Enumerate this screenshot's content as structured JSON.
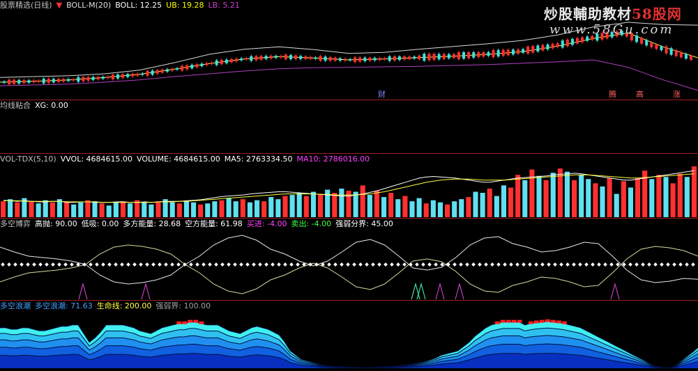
{
  "watermark": {
    "main": "炒股輔助教材",
    "brand": "58股网",
    "url": "www.58Gu.com"
  },
  "panels": {
    "boll": {
      "title": "股票精选(日线)",
      "indicator": "BOLL-M(20)",
      "items": [
        {
          "name": "BOLL",
          "value": "12.25",
          "color": "#ffffff"
        },
        {
          "name": "UB",
          "value": "19.28",
          "color": "#ffff00"
        },
        {
          "name": "LB",
          "value": "5.21",
          "color": "#d040d0"
        }
      ],
      "markers": [
        "财",
        "腾",
        "高",
        "涨"
      ]
    },
    "xg": {
      "title": "均线粘合",
      "items": [
        {
          "name": "XG",
          "value": "0.00",
          "color": "#ffffff"
        }
      ]
    },
    "vol": {
      "title": "VOL-TDX(5,10)",
      "items": [
        {
          "name": "VVOL",
          "value": "4684615.00",
          "color": "#ffffff"
        },
        {
          "name": "VOLUME",
          "value": "4684615.00",
          "color": "#ffffff"
        },
        {
          "name": "MA5",
          "value": "2763334.50",
          "color": "#ffffff"
        },
        {
          "name": "MA10",
          "value": "2786016.00",
          "color": "#ff40ff"
        }
      ]
    },
    "duokong": {
      "title": "多空博弈",
      "items": [
        {
          "name": "高抛",
          "value": "90.00",
          "color": "#ffffff"
        },
        {
          "name": "低吸",
          "value": "0.00",
          "color": "#ffffff"
        },
        {
          "name": "多方能量",
          "value": "28.68",
          "color": "#ffffff"
        },
        {
          "name": "空方能量",
          "value": "61.98",
          "color": "#ffffff"
        },
        {
          "name": "买进",
          "value": "-4.00",
          "color": "#ff40ff"
        },
        {
          "name": "卖出",
          "value": "-4.00",
          "color": "#40ff40"
        },
        {
          "name": "强弱分界",
          "value": "45.00",
          "color": "#ffffff"
        }
      ]
    },
    "wave": {
      "title": "多空浪潮",
      "items": [
        {
          "name": "多空浪潮",
          "value": "71.63",
          "color": "#40a0ff"
        },
        {
          "name": "生命线",
          "value": "200.00",
          "color": "#ffff40"
        },
        {
          "name": "强弱界",
          "value": "100.00",
          "color": "#a0a0a0"
        }
      ]
    }
  },
  "chart_data": [
    {
      "type": "line",
      "title": "BOLL-M(20)",
      "x": [
        0,
        10,
        20,
        30,
        40,
        50,
        60,
        70,
        80,
        90,
        100,
        110,
        120,
        130,
        140,
        150,
        160,
        170,
        180,
        190,
        200
      ],
      "series": [
        {
          "name": "UB",
          "values": [
            8.0,
            8.2,
            8.4,
            8.8,
            9.6,
            11.2,
            13.0,
            14.1,
            14.6,
            14.0,
            13.2,
            13.4,
            14.1,
            14.7,
            15.3,
            16.0,
            17.2,
            18.9,
            19.9,
            19.4,
            19.28
          ]
        },
        {
          "name": "BOLL",
          "values": [
            7.0,
            7.2,
            7.5,
            8.0,
            8.7,
            9.8,
            11.0,
            12.0,
            12.5,
            12.2,
            11.8,
            12.0,
            12.3,
            12.6,
            13.0,
            13.6,
            14.8,
            16.4,
            17.6,
            14.6,
            12.25
          ]
        },
        {
          "name": "LB",
          "values": [
            6.2,
            6.4,
            6.6,
            7.0,
            7.5,
            8.2,
            8.8,
            9.4,
            9.9,
            10.1,
            10.2,
            10.3,
            10.4,
            10.6,
            10.8,
            11.1,
            11.4,
            11.8,
            10.2,
            7.5,
            5.21
          ]
        }
      ]
    },
    {
      "type": "bar",
      "title": "VOL-TDX(5,10)",
      "values": [
        30,
        34,
        28,
        36,
        30,
        26,
        32,
        28,
        34,
        30,
        24,
        28,
        32,
        30,
        26,
        22,
        28,
        30,
        26,
        32,
        28,
        24,
        30,
        34,
        28,
        26,
        30,
        28,
        24,
        26,
        30,
        32,
        36,
        30,
        34,
        28,
        32,
        30,
        38,
        34,
        40,
        42,
        46,
        40,
        48,
        44,
        52,
        46,
        54,
        50,
        48,
        60,
        42,
        50,
        38,
        46,
        34,
        40,
        30,
        36,
        26,
        32,
        28,
        24,
        30,
        34,
        38,
        48,
        46,
        54,
        40,
        60,
        56,
        80,
        70,
        90,
        78,
        70,
        84,
        92,
        86,
        70,
        80,
        72,
        64,
        58,
        74,
        44,
        68,
        56,
        74,
        88,
        72,
        80,
        76,
        64,
        82,
        76,
        96
      ],
      "red_indices": [
        0,
        2,
        4,
        7,
        9,
        12,
        14,
        17,
        19,
        22,
        25,
        28,
        31,
        34,
        37,
        40,
        43,
        45,
        47,
        49,
        51,
        53,
        55,
        57,
        60,
        63,
        66,
        69,
        72,
        73,
        75,
        77,
        79,
        81,
        84,
        86,
        88,
        90,
        91,
        93,
        95,
        96,
        98
      ],
      "ma5": [
        32,
        31,
        30,
        31,
        30,
        29,
        29,
        30,
        30,
        28,
        28,
        29,
        29,
        28,
        28,
        28,
        29,
        29,
        28,
        28,
        29,
        28,
        29,
        30,
        30,
        30,
        31,
        32,
        33,
        35,
        37,
        39,
        40,
        41,
        42,
        44,
        45,
        46,
        47,
        48,
        48,
        47,
        46,
        45,
        44,
        43,
        42,
        41,
        40,
        40,
        42,
        44,
        47,
        50,
        54,
        58,
        62,
        66,
        70,
        74,
        76,
        77,
        76,
        75,
        74,
        72,
        70,
        68,
        66,
        66,
        68,
        70,
        72,
        74,
        75,
        76,
        77,
        78,
        80,
        81,
        82,
        83,
        82,
        80,
        78,
        76,
        74,
        72,
        70,
        70,
        72,
        74,
        76,
        78,
        80,
        82,
        84,
        86,
        88
      ],
      "ma10": [
        31,
        31,
        31,
        30,
        30,
        30,
        30,
        30,
        30,
        29,
        29,
        29,
        29,
        29,
        28,
        28,
        28,
        28,
        28,
        28,
        28,
        28,
        29,
        29,
        29,
        30,
        30,
        31,
        32,
        33,
        34,
        35,
        36,
        37,
        38,
        39,
        40,
        41,
        42,
        43,
        44,
        44,
        44,
        44,
        44,
        43,
        43,
        42,
        42,
        42,
        42,
        43,
        44,
        46,
        48,
        51,
        54,
        57,
        60,
        63,
        66,
        68,
        70,
        71,
        72,
        72,
        72,
        71,
        70,
        70,
        70,
        70,
        71,
        72,
        73,
        74,
        75,
        76,
        77,
        78,
        79,
        80,
        80,
        80,
        79,
        78,
        77,
        76,
        75,
        74,
        74,
        75,
        76,
        77,
        78,
        79,
        80,
        81,
        82
      ]
    },
    {
      "type": "line",
      "title": "多空博弈",
      "ylim": [
        0,
        100
      ],
      "series": [
        {
          "name": "多方能量",
          "values": [
            75,
            68,
            62,
            60,
            58,
            55,
            50,
            35,
            25,
            22,
            24,
            28,
            35,
            50,
            62,
            78,
            88,
            92,
            85,
            72,
            65,
            55,
            48,
            55,
            68,
            82,
            86,
            78,
            62,
            45,
            42,
            46,
            60,
            78,
            88,
            90,
            80,
            75,
            68,
            70,
            75,
            82,
            80,
            62,
            42,
            28,
            24,
            26,
            30,
            28.68
          ]
        },
        {
          "name": "空方能量",
          "values": [
            25,
            32,
            38,
            40,
            42,
            45,
            50,
            65,
            75,
            78,
            76,
            72,
            65,
            50,
            38,
            22,
            12,
            8,
            15,
            28,
            35,
            45,
            52,
            45,
            32,
            18,
            14,
            22,
            38,
            55,
            58,
            54,
            40,
            22,
            12,
            10,
            20,
            25,
            32,
            30,
            25,
            18,
            20,
            38,
            58,
            72,
            76,
            74,
            70,
            61.98
          ]
        }
      ]
    },
    {
      "type": "area",
      "title": "多空浪潮",
      "ylim": [
        0,
        200
      ],
      "values": [
        140,
        140,
        135,
        135,
        140,
        140,
        135,
        130,
        130,
        135,
        140,
        145,
        145,
        150,
        150,
        120,
        90,
        105,
        125,
        150,
        150,
        150,
        150,
        145,
        140,
        130,
        125,
        120,
        130,
        140,
        145,
        150,
        155,
        155,
        160,
        160,
        155,
        150,
        150,
        150,
        140,
        130,
        125,
        120,
        130,
        140,
        145,
        140,
        135,
        125,
        115,
        90,
        60,
        45,
        30,
        25,
        20,
        15,
        10,
        8,
        6,
        5,
        4,
        3,
        3,
        2,
        2,
        3,
        4,
        5,
        6,
        8,
        10,
        12,
        15,
        18,
        22,
        28,
        35,
        45,
        50,
        55,
        60,
        75,
        90,
        110,
        125,
        140,
        150,
        155,
        160,
        160,
        160,
        160,
        150,
        155,
        158,
        160,
        162,
        160,
        158,
        155,
        150,
        145,
        140,
        130,
        120,
        110,
        100,
        90,
        80,
        70,
        60,
        50,
        40,
        30,
        20,
        10,
        5,
        2,
        2,
        10,
        25,
        40,
        55,
        71.63
      ]
    }
  ]
}
